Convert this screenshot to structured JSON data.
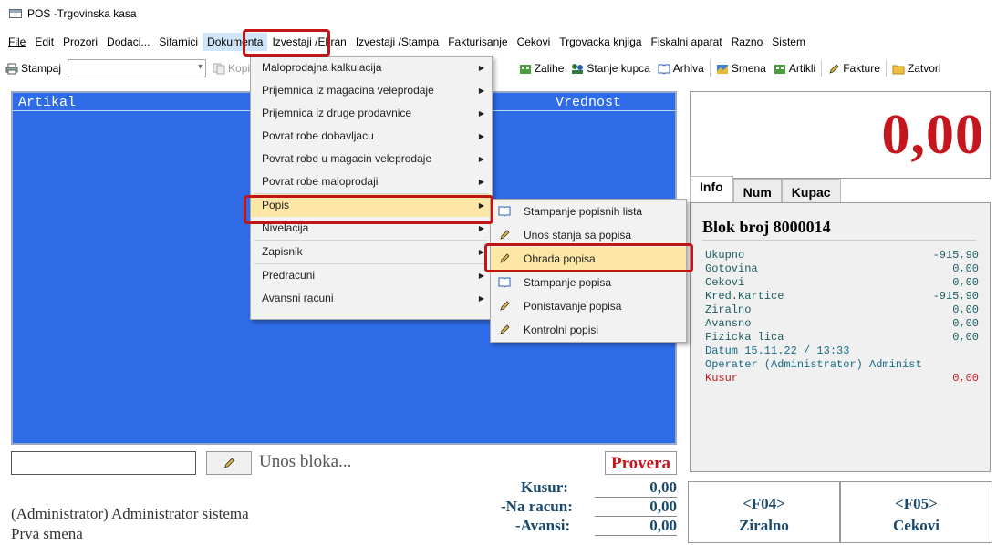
{
  "window": {
    "title": "POS -Trgovinska kasa"
  },
  "menubar": [
    "File",
    "Edit",
    "Prozori",
    "Dodaci...",
    "Sifarnici",
    "Dokumenta",
    "Izvestaji /Ekran",
    "Izvestaji /Stampa",
    "Fakturisanje",
    "Cekovi",
    "Trgovacka knjiga",
    "Fiskalni aparat",
    "Razno",
    "Sistem"
  ],
  "toolbar": {
    "stampaj": "Stampaj",
    "kopira": "Kopira",
    "zalihe": "Zalihe",
    "stanje_kupca": "Stanje kupca",
    "arhiva": "Arhiva",
    "smena": "Smena",
    "artikli": "Artikli",
    "fakture": "Fakture",
    "zatvori": "Zatvori"
  },
  "grid": {
    "col_artikal": "Artikal",
    "col_vrednost": "Vrednost"
  },
  "total": {
    "amount": "0,00"
  },
  "tabs": [
    "Info",
    "Num",
    "Kupac"
  ],
  "info": {
    "blok": "Blok broj 8000014",
    "rows": [
      {
        "label": "Ukupno",
        "value": "-915,90"
      },
      {
        "label": "Gotovina",
        "value": "0,00"
      },
      {
        "label": "Cekovi",
        "value": "0,00"
      },
      {
        "label": "Kred.Kartice",
        "value": "-915,90"
      },
      {
        "label": "Ziralno",
        "value": "0,00"
      },
      {
        "label": "Avansno",
        "value": "0,00"
      },
      {
        "label": "Fizicka lica",
        "value": "0,00"
      }
    ],
    "datum": "Datum 15.11.22 / 13:33",
    "operater": "Operater (Administrator) Administ",
    "kusur_label": "Kusur",
    "kusur_value": "0,00"
  },
  "input": {
    "unos_label": "Unos bloka...",
    "provera": "Provera"
  },
  "summary": {
    "kusur_label": "Kusur:",
    "kusur_value": "0,00",
    "na_racun_label": "-Na racun:",
    "na_racun_value": "0,00",
    "avansi_label": "-Avansi:",
    "avansi_value": "0,00"
  },
  "status": {
    "user": "(Administrator) Administrator sistema",
    "shift": "Prva smena"
  },
  "fkeys": [
    {
      "key": "<F04>",
      "label": "Ziralno"
    },
    {
      "key": "<F05>",
      "label": "Cekovi"
    }
  ],
  "dokumenta_menu": [
    "Maloprodajna kalkulacija",
    "Prijemnica iz magacina veleprodaje",
    "Prijemnica iz druge prodavnice",
    "Povrat robe dobavljacu",
    "Povrat robe u magacin veleprodaje",
    "Povrat robe maloprodaji",
    "Popis",
    "Nivelacija",
    "Zapisnik",
    "Predracuni",
    "Avansni racuni"
  ],
  "popis_submenu": [
    "Stampanje popisnih lista",
    "Unos stanja sa popisa",
    "Obrada popisa",
    "Stampanje popisa",
    "Ponistavanje popisa",
    "Kontrolni popisi"
  ],
  "colors": {
    "grid_bg": "#2e6be6",
    "total_red": "#c4161c",
    "highlight": "#fde7a6",
    "annotation": "#c01616"
  }
}
